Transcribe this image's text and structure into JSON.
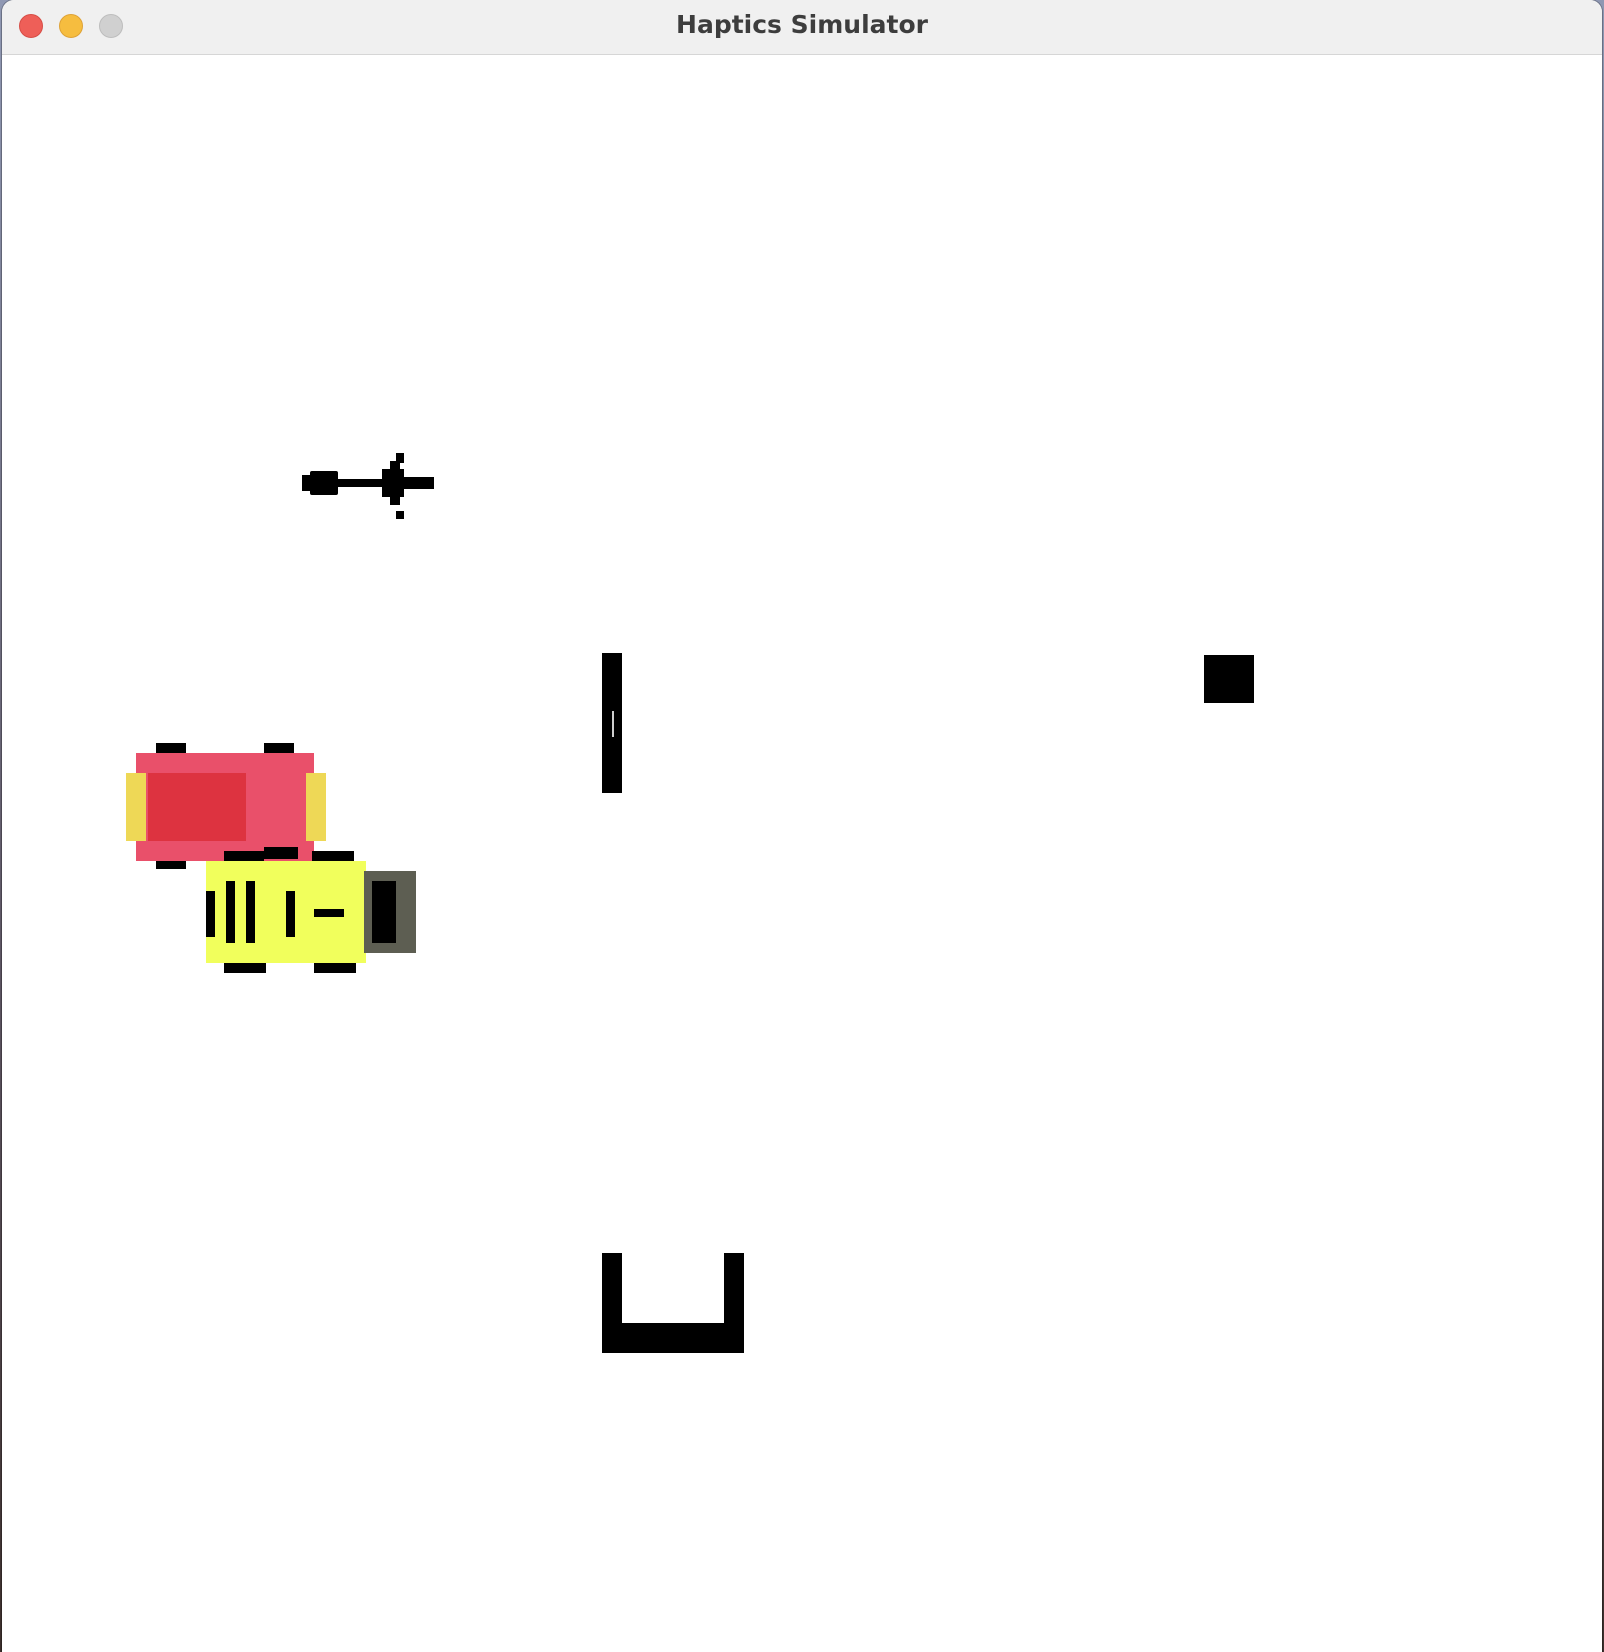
{
  "window": {
    "title": "Haptics Simulator"
  },
  "scene": {
    "sprites": [
      {
        "name": "handle-avatar",
        "kind": "pixel-arrow"
      },
      {
        "name": "red-car",
        "kind": "pixel-car",
        "body_color": "#e9506a",
        "cabin_color": "#dd3340",
        "light_color": "#eed856"
      },
      {
        "name": "yellow-car",
        "kind": "pixel-car",
        "body_color": "#f1ff5c",
        "bumper_color": "#5d5e52"
      },
      {
        "name": "vertical-wall",
        "kind": "bar"
      },
      {
        "name": "square-block",
        "kind": "block"
      },
      {
        "name": "u-container",
        "kind": "bracket"
      }
    ]
  },
  "colors": {
    "close": "#ee5f58",
    "minimize": "#f6bd3f",
    "maximize": "#d0d0d0",
    "titlebar": "#f0f0f0",
    "canvas": "#ffffff",
    "ink": "#000000"
  }
}
